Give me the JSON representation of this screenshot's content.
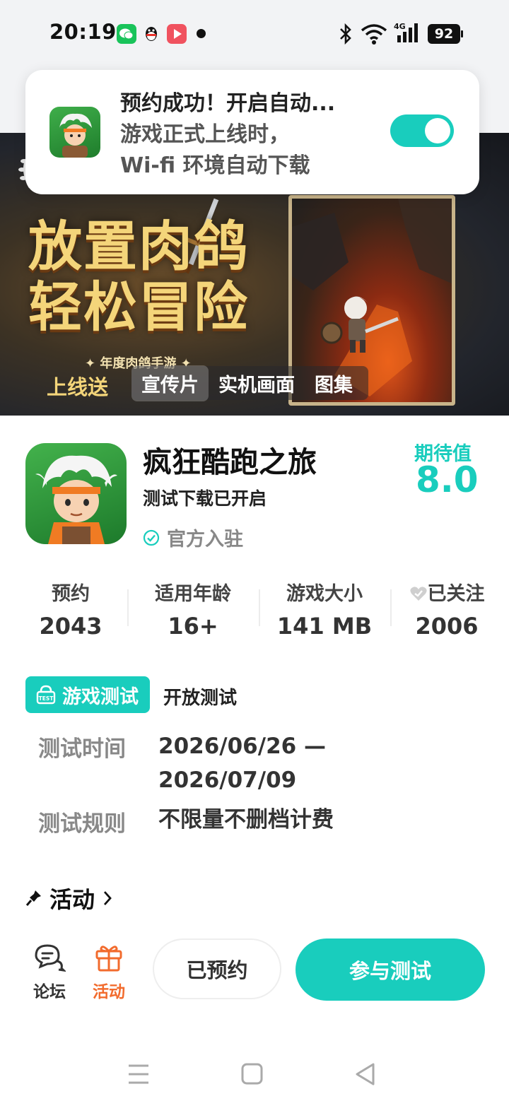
{
  "status_bar": {
    "time": "20:19",
    "network": "4G",
    "battery": "92",
    "icons": [
      "wechat-icon",
      "qq-icon",
      "video-app-icon",
      "notification-dot",
      "bluetooth-icon",
      "wifi-icon",
      "signal-icon",
      "battery-icon"
    ]
  },
  "notification": {
    "title": "预约成功！开启自动...",
    "body_line1": "游戏正式上线时，",
    "body_line2": "Wi-fi 环境自动下载",
    "toggle_on": true
  },
  "banner": {
    "title_line1": "放置肉鸽",
    "title_line2": "轻松冒险",
    "subtitle": "✦ 年度肉鸽手游 ✦",
    "bottom_text": "上线送",
    "tabs": [
      "宣传片",
      "实机画面",
      "图集"
    ],
    "active_tab": 0
  },
  "game": {
    "name": "疯狂酷跑之旅",
    "status": "测试下载已开启",
    "official": "官方入驻",
    "expect_label": "期待值",
    "expect_value": "8.0"
  },
  "stats": [
    {
      "label": "预约",
      "value": "2043"
    },
    {
      "label": "适用年龄",
      "value": "16+"
    },
    {
      "label": "游戏大小",
      "value": "141 MB"
    },
    {
      "label": "已关注",
      "value": "2006"
    }
  ],
  "test": {
    "badge": "游戏测试",
    "badge_icon_text": "TEST",
    "type": "开放测试",
    "time_label": "测试时间",
    "time_value_line1": "2026/06/26 —",
    "time_value_line2": "2026/07/09",
    "rule_label": "测试规则",
    "rule_value": "不限量不删档计费"
  },
  "activity": {
    "label": "活动"
  },
  "bottom_bar": {
    "forum_label": "论坛",
    "activity_label": "活动",
    "reserved_label": "已预约",
    "join_label": "参与测试"
  },
  "colors": {
    "accent": "#19cdbd",
    "activity_orange": "#f26b2d"
  }
}
